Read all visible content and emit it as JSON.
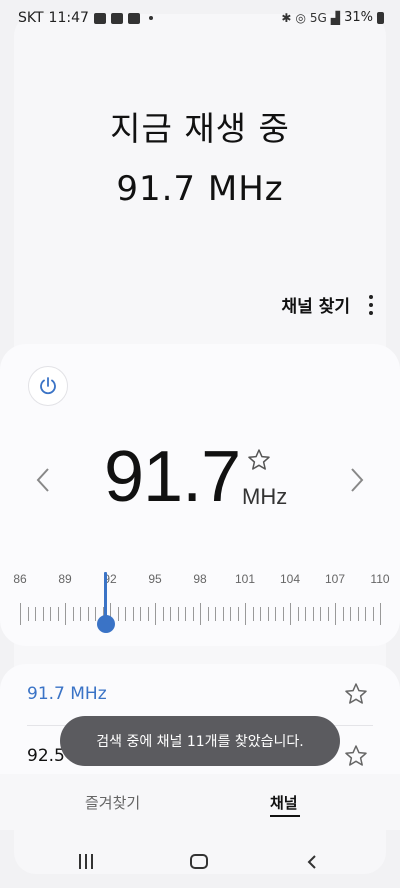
{
  "status": {
    "carrier": "SKT",
    "time": "11:47",
    "battery": "31%",
    "network": "5G"
  },
  "now_playing": {
    "title": "지금 재생 중",
    "frequency": "91.7 MHz"
  },
  "top_actions": {
    "find_channels": "채널 찾기"
  },
  "tuner": {
    "frequency": "91.7",
    "unit": "MHz",
    "favorite": false,
    "scale_labels": [
      "86",
      "89",
      "92",
      "95",
      "98",
      "101",
      "104",
      "107",
      "110"
    ],
    "scale_min": 86,
    "scale_max": 110,
    "current_value": 91.7,
    "accent_color": "#3a73c6"
  },
  "channels": [
    {
      "frequency": "91.7 MHz",
      "active": true,
      "favorite": false
    },
    {
      "frequency": "92.5 MHz",
      "active": false,
      "favorite": false
    }
  ],
  "toast": {
    "message": "검색 중에 채널 11개를 찾았습니다."
  },
  "tabs": {
    "favorites": "즐겨찾기",
    "channels": "채널",
    "selected": "채널"
  }
}
